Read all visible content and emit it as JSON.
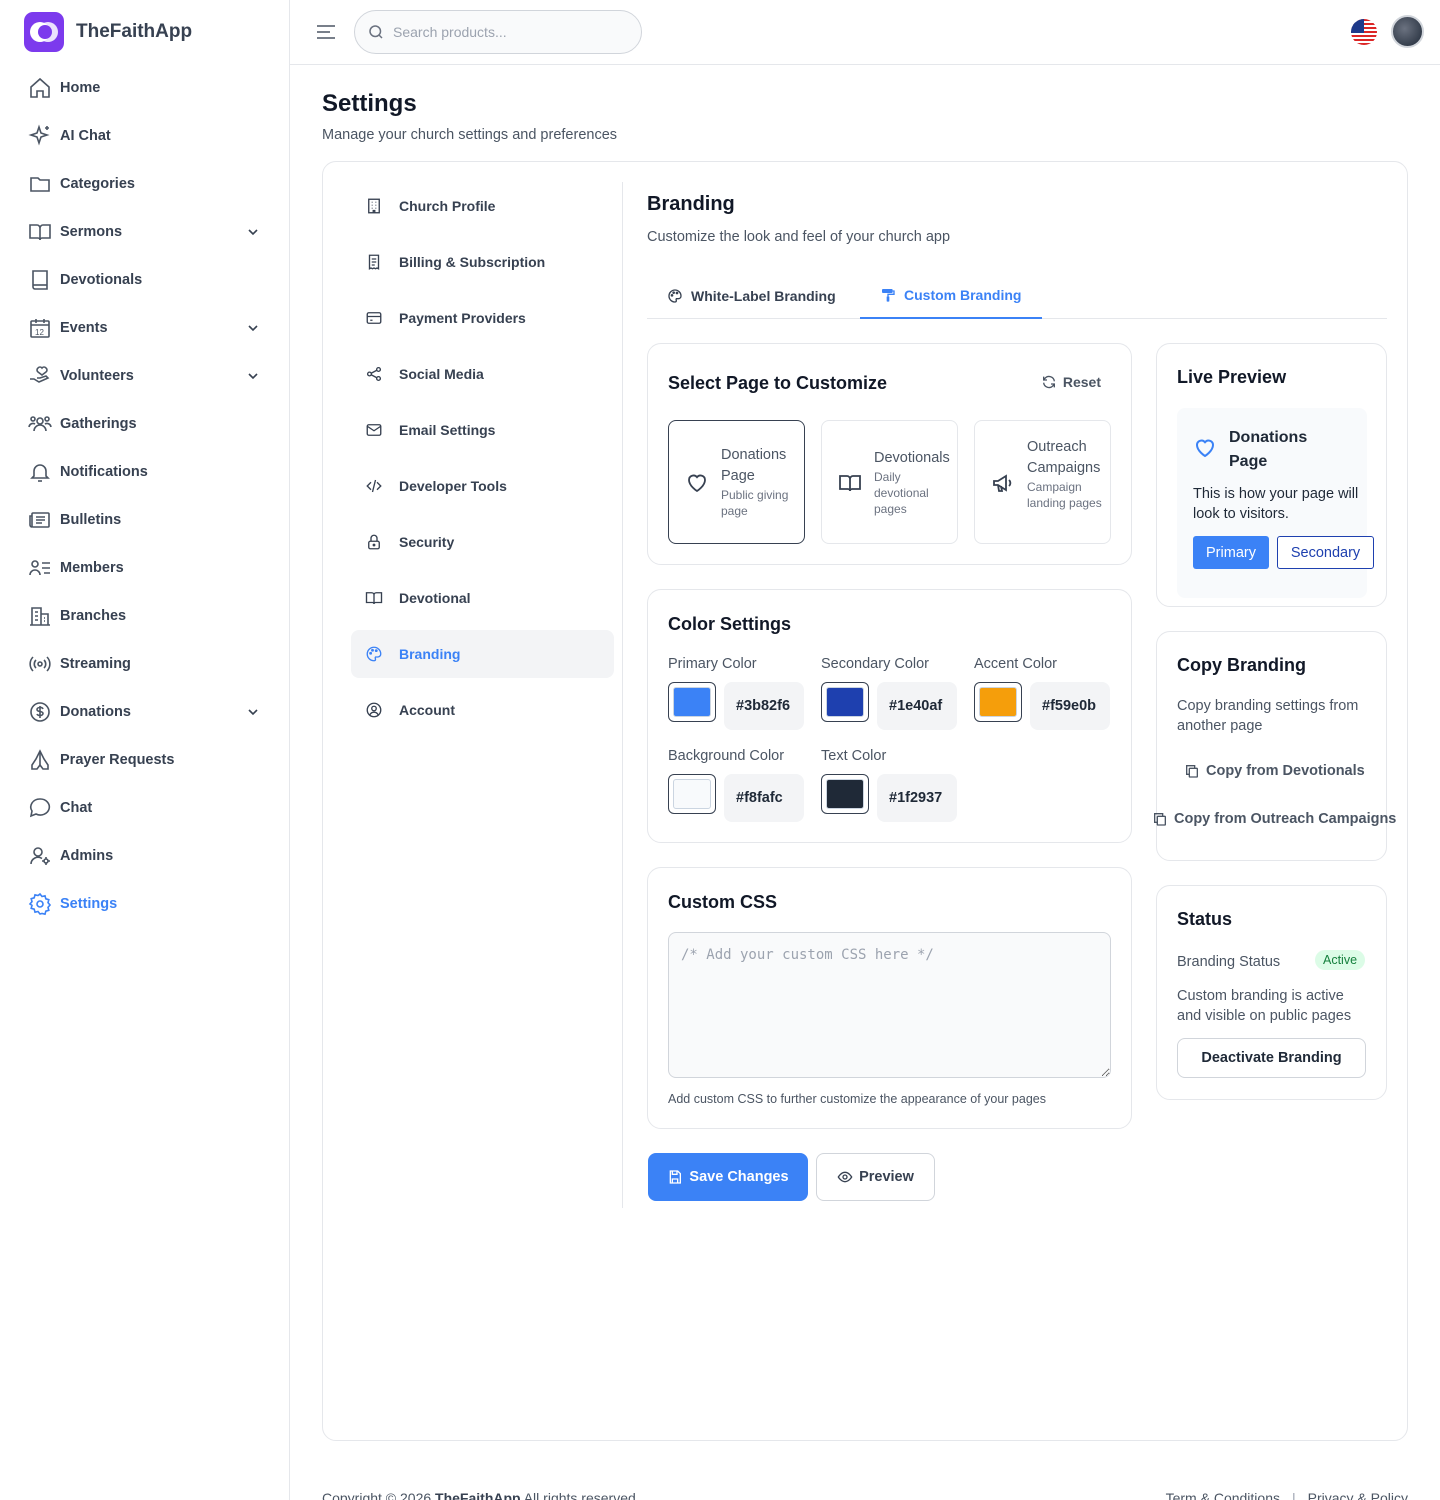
{
  "app": {
    "name": "TheFaithApp",
    "brand_color": "#7c3aed"
  },
  "sidebar": {
    "items": [
      {
        "label": "Home",
        "icon": "home-icon"
      },
      {
        "label": "AI Chat",
        "icon": "sparkles-icon"
      },
      {
        "label": "Categories",
        "icon": "folder-icon"
      },
      {
        "label": "Sermons",
        "icon": "book-open-icon",
        "expandable": true
      },
      {
        "label": "Devotionals",
        "icon": "book-icon"
      },
      {
        "label": "Events",
        "icon": "calendar-icon",
        "expandable": true
      },
      {
        "label": "Volunteers",
        "icon": "hand-heart-icon",
        "expandable": true
      },
      {
        "label": "Gatherings",
        "icon": "users-icon"
      },
      {
        "label": "Notifications",
        "icon": "bell-icon"
      },
      {
        "label": "Bulletins",
        "icon": "newspaper-icon"
      },
      {
        "label": "Members",
        "icon": "user-list-icon"
      },
      {
        "label": "Branches",
        "icon": "building-icon"
      },
      {
        "label": "Streaming",
        "icon": "broadcast-icon"
      },
      {
        "label": "Donations",
        "icon": "dollar-circle-icon",
        "expandable": true
      },
      {
        "label": "Prayer Requests",
        "icon": "praying-hands-icon"
      },
      {
        "label": "Chat",
        "icon": "chat-bubble-icon"
      },
      {
        "label": "Admins",
        "icon": "user-cog-icon"
      },
      {
        "label": "Settings",
        "icon": "gear-icon",
        "active": true
      }
    ]
  },
  "header": {
    "search_placeholder": "Search products...",
    "language_flag": "us-flag-icon"
  },
  "page": {
    "title": "Settings",
    "subtitle": "Manage your church settings and preferences"
  },
  "settings_nav": {
    "items": [
      {
        "label": "Church Profile",
        "icon": "building-icon"
      },
      {
        "label": "Billing & Subscription",
        "icon": "receipt-icon"
      },
      {
        "label": "Payment Providers",
        "icon": "credit-card-icon"
      },
      {
        "label": "Social Media",
        "icon": "share-icon"
      },
      {
        "label": "Email Settings",
        "icon": "mail-icon"
      },
      {
        "label": "Developer Tools",
        "icon": "code-icon"
      },
      {
        "label": "Security",
        "icon": "lock-icon"
      },
      {
        "label": "Devotional",
        "icon": "book-open-icon"
      },
      {
        "label": "Branding",
        "icon": "palette-icon",
        "active": true
      },
      {
        "label": "Account",
        "icon": "user-circle-icon"
      }
    ]
  },
  "branding": {
    "title": "Branding",
    "subtitle": "Customize the look and feel of your church app",
    "tabs": [
      {
        "label": "White-Label Branding",
        "icon": "palette-icon"
      },
      {
        "label": "Custom Branding",
        "icon": "paint-roller-icon",
        "active": true
      }
    ],
    "page_select": {
      "title": "Select Page to Customize",
      "reset_label": "Reset",
      "options": [
        {
          "name": "Donations Page",
          "desc": "Public giving page",
          "icon": "heart-icon",
          "selected": true
        },
        {
          "name": "Devotionals",
          "desc": "Daily devotional pages",
          "icon": "book-open-icon"
        },
        {
          "name": "Outreach Campaigns",
          "desc": "Campaign landing pages",
          "icon": "megaphone-icon"
        }
      ]
    },
    "colors": {
      "title": "Color Settings",
      "primary": {
        "label": "Primary Color",
        "value": "#3b82f6"
      },
      "secondary": {
        "label": "Secondary Color",
        "value": "#1e40af"
      },
      "accent": {
        "label": "Accent Color",
        "value": "#f59e0b"
      },
      "background": {
        "label": "Background Color",
        "value": "#f8fafc"
      },
      "text": {
        "label": "Text Color",
        "value": "#1f2937"
      }
    },
    "custom_css": {
      "title": "Custom CSS",
      "placeholder": "/* Add your custom CSS here */",
      "value": "",
      "help": "Add custom CSS to further customize the appearance of your pages"
    },
    "actions": {
      "save_label": "Save Changes",
      "preview_label": "Preview"
    },
    "live_preview": {
      "title": "Live Preview",
      "page_title": "Donations Page",
      "text": "This is how your page will look to visitors.",
      "primary_label": "Primary",
      "secondary_label": "Secondary"
    },
    "copy_branding": {
      "title": "Copy Branding",
      "desc": "Copy branding settings from another page",
      "buttons": [
        "Copy from Devotionals",
        "Copy from Outreach Campaigns"
      ]
    },
    "status": {
      "title": "Status",
      "label": "Branding Status",
      "badge": "Active",
      "desc": "Custom branding is active and visible on public pages",
      "deactivate_label": "Deactivate Branding"
    }
  },
  "footer": {
    "copyright_prefix": "Copyright © 2026",
    "copyright_brand": "TheFaithApp",
    "copyright_suffix": "All rights reserved",
    "links": [
      "Term & Conditions",
      "Privacy & Policy"
    ]
  }
}
